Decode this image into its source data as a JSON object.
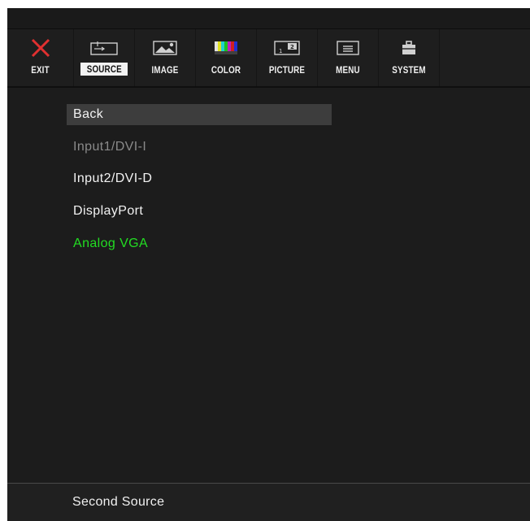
{
  "toolbar": {
    "tabs": [
      {
        "id": "exit",
        "label": "EXIT",
        "icon": "close-icon"
      },
      {
        "id": "source",
        "label": "SOURCE",
        "icon": "source-input-icon",
        "selected": true
      },
      {
        "id": "image",
        "label": "IMAGE",
        "icon": "image-icon"
      },
      {
        "id": "color",
        "label": "COLOR",
        "icon": "color-bars-icon"
      },
      {
        "id": "picture",
        "label": "PICTURE",
        "icon": "picture-in-picture-icon"
      },
      {
        "id": "menu",
        "label": "MENU",
        "icon": "menu-icon"
      },
      {
        "id": "system",
        "label": "SYSTEM",
        "icon": "toolbox-icon"
      }
    ]
  },
  "menu": {
    "items": [
      {
        "label": "Back",
        "state": "highlighted",
        "color": "#f2f2f2"
      },
      {
        "label": "Input1/DVI-I",
        "state": "disabled",
        "color": "#8a8a8a"
      },
      {
        "label": "Input2/DVI-D",
        "state": "normal",
        "color": "#f2f2f2"
      },
      {
        "label": "DisplayPort",
        "state": "normal",
        "color": "#f2f2f2"
      },
      {
        "label": "Analog VGA",
        "state": "active",
        "color": "#22dd22"
      }
    ],
    "highlight_bg": "#3d3d3d"
  },
  "footer": {
    "label": "Second Source"
  },
  "colors": {
    "exit_x": "#e03030",
    "background": "#1c1c1c",
    "active_source": "#22dd22"
  }
}
